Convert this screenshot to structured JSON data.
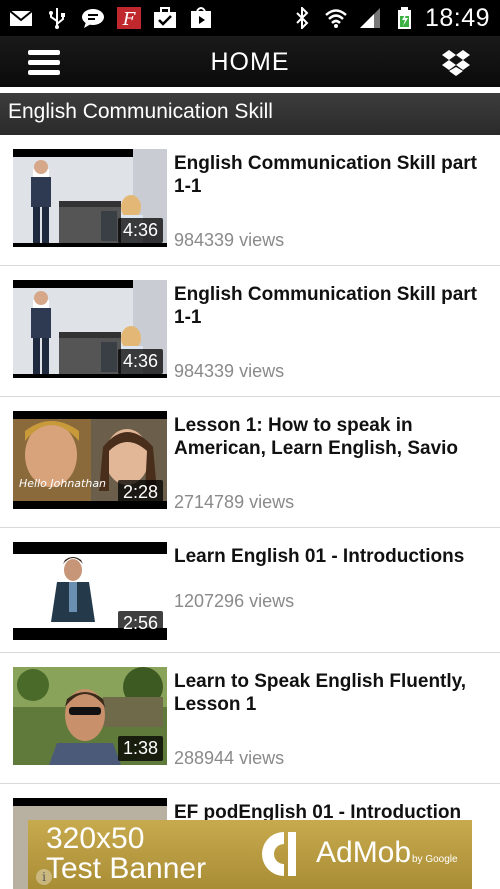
{
  "status_bar": {
    "left_icons": [
      "mail-icon",
      "usb-icon",
      "chat-icon",
      "flipboard-icon",
      "briefcase-check-icon",
      "play-store-icon"
    ],
    "right_icons": [
      "bluetooth-icon",
      "wifi-icon",
      "signal-icon",
      "battery-icon"
    ],
    "time": "18:49"
  },
  "action_bar": {
    "title": "HOME",
    "menu_icon": "hamburger-menu-icon",
    "dropbox_icon": "dropbox-icon"
  },
  "section": {
    "title": "English Communication Skill"
  },
  "videos": [
    {
      "title": "English Communication Skill part 1-1",
      "views": "984339 views",
      "duration": "4:36"
    },
    {
      "title": "English Communication Skill part 1-1",
      "views": "984339 views",
      "duration": "4:36"
    },
    {
      "title": "Lesson 1: How to speak in American, Learn English, Savio",
      "views": "2714789 views",
      "duration": "2:28",
      "caption": "Hello Johnathan"
    },
    {
      "title": "Learn English 01 - Introductions",
      "views": "1207296 views",
      "duration": "2:56"
    },
    {
      "title": "Learn to Speak English Fluently, Lesson 1",
      "views": "288944 views",
      "duration": "1:38"
    },
    {
      "title": "EF podEnglish 01 - Introduction",
      "views": "",
      "duration": ""
    }
  ],
  "ad": {
    "line1": "320x50",
    "line2": "Test Banner",
    "brand": "AdMob",
    "by": "by Google",
    "info": "i"
  },
  "colors": {
    "status_bar": "#000000",
    "action_bar": "#111111",
    "section_header": "#333333",
    "views_text": "#8a8a8a",
    "ad_background": "#b89a42"
  }
}
